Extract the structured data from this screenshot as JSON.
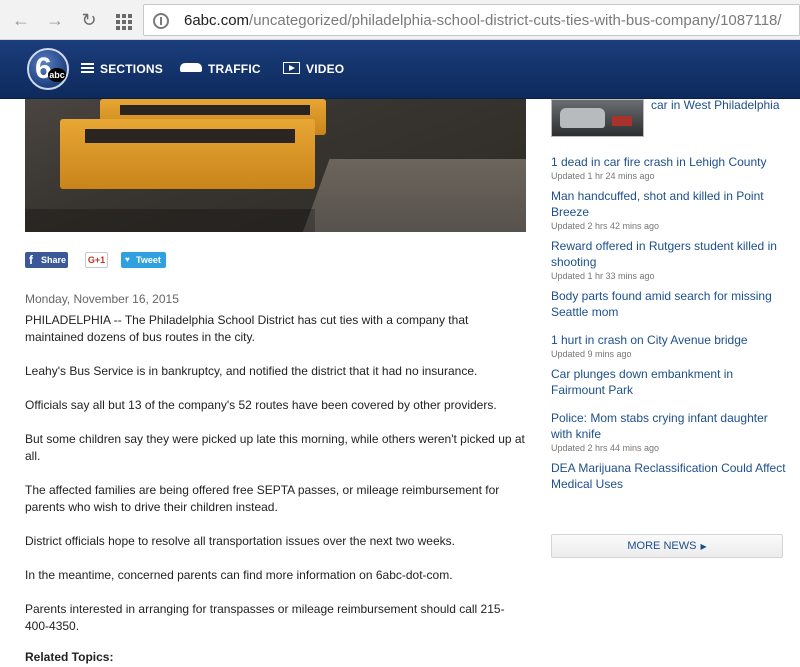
{
  "browser": {
    "url_host": "6abc.com",
    "url_path": "/uncategorized/philadelphia-school-district-cuts-ties-with-bus-company/1087118/"
  },
  "header": {
    "logo_text": "6",
    "logo_sub": "abc",
    "nav": [
      {
        "label": "SECTIONS",
        "icon": "hamburger-icon"
      },
      {
        "label": "TRAFFIC",
        "icon": "car-icon"
      },
      {
        "label": "VIDEO",
        "icon": "video-icon"
      }
    ],
    "brand_color": "#16366f"
  },
  "share": {
    "facebook": "Share",
    "google": "G+1",
    "twitter": "Tweet"
  },
  "article": {
    "date": "Monday, November 16, 2015",
    "paragraphs": [
      "PHILADELPHIA -- The Philadelphia School District has cut ties with a company that maintained dozens of bus routes in the city.",
      "Leahy's Bus Service is in bankruptcy, and notified the district that it had no insurance.",
      "Officials say all but 13 of the company's 52 routes have been covered by other providers.",
      "But some children say they were picked up late this morning, while others weren't picked up at all.",
      "The affected families are being offered free SEPTA passes, or mileage reimbursement for parents who wish to drive their children instead.",
      "District officials hope to resolve all transportation issues over the next two weeks.",
      "In the meantime, concerned parents can find more information on 6abc-dot-com.",
      "Parents interested in arranging for transpasses or mileage reimbursement should call 215-400-4350."
    ],
    "related_label": "Related Topics:"
  },
  "sidebar": {
    "first_headline": "car in West Philadelphia",
    "items": [
      {
        "title": "1 dead in car fire crash in Lehigh County",
        "updated": "Updated 1 hr 24 mins ago"
      },
      {
        "title": "Man handcuffed, shot and killed in Point Breeze",
        "updated": "Updated 2 hrs 42 mins ago"
      },
      {
        "title": "Reward offered in Rutgers student killed in shooting",
        "updated": "Updated 1 hr 33 mins ago"
      },
      {
        "title": "Body parts found amid search for missing Seattle mom",
        "updated": ""
      },
      {
        "title": "1 hurt in crash on City Avenue bridge",
        "updated": "Updated 9 mins ago"
      },
      {
        "title": "Car plunges down embankment in Fairmount Park",
        "updated": ""
      },
      {
        "title": "Police: Mom stabs crying infant daughter with knife",
        "updated": "Updated 2 hrs 44 mins ago"
      },
      {
        "title": "DEA Marijuana Reclassification Could Affect Medical Uses",
        "updated": ""
      }
    ],
    "more_news": "MORE NEWS",
    "link_color": "#1d4f8c"
  }
}
